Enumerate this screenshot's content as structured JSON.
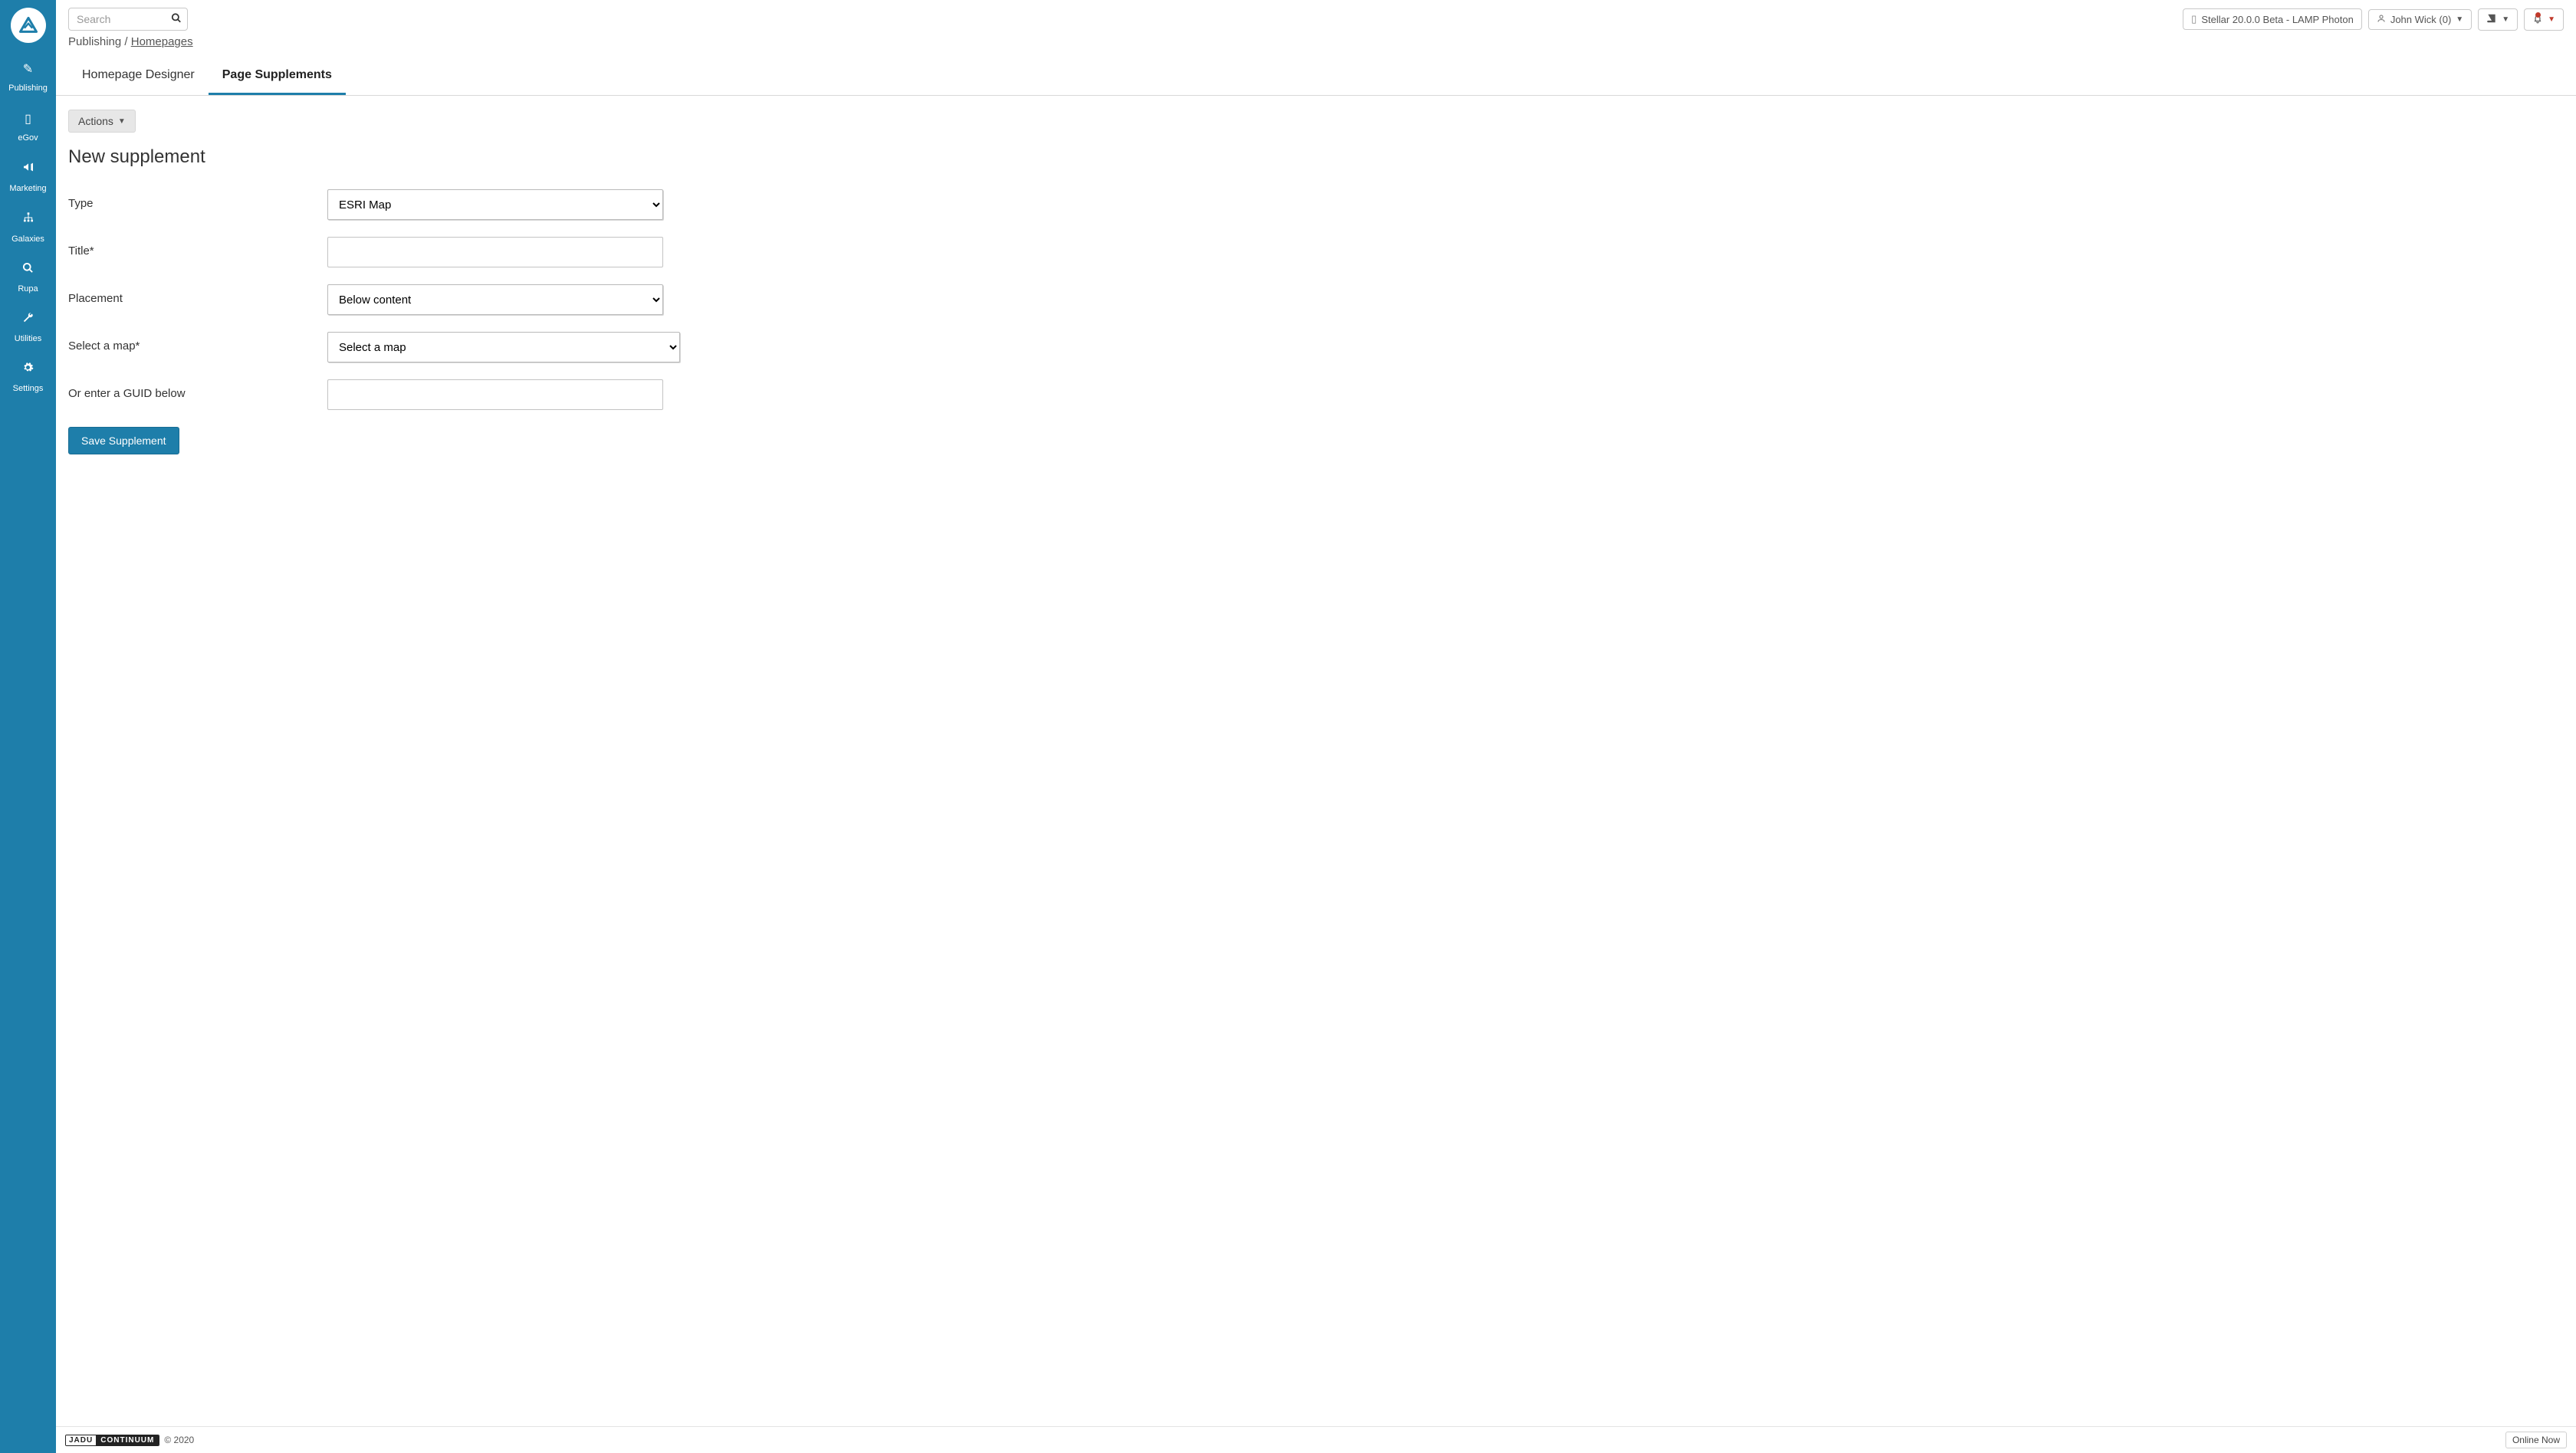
{
  "sidebar": {
    "items": [
      {
        "label": "Publishing"
      },
      {
        "label": "eGov"
      },
      {
        "label": "Marketing"
      },
      {
        "label": "Galaxies"
      },
      {
        "label": "Rupa"
      },
      {
        "label": "Utilities"
      },
      {
        "label": "Settings"
      }
    ]
  },
  "header": {
    "search_placeholder": "Search",
    "site_label": "Stellar 20.0.0 Beta - LAMP Photon",
    "user_label": "John Wick (0)"
  },
  "breadcrumb": {
    "section": "Publishing",
    "separator": "/",
    "page": "Homepages"
  },
  "tabs": [
    {
      "label": "Homepage Designer",
      "active": false
    },
    {
      "label": "Page Supplements",
      "active": true
    }
  ],
  "actions_label": "Actions",
  "page_heading": "New supplement",
  "form": {
    "type": {
      "label": "Type",
      "value": "ESRI Map"
    },
    "title": {
      "label": "Title*",
      "value": ""
    },
    "placement": {
      "label": "Placement",
      "value": "Below content"
    },
    "map": {
      "label": "Select a map*",
      "value": "Select a map"
    },
    "guid": {
      "label": "Or enter a GUID below",
      "value": ""
    },
    "save_label": "Save Supplement"
  },
  "footer": {
    "brand_left": "JADU",
    "brand_right": "CONTINUUM",
    "copyright": "© 2020",
    "online_label": "Online Now"
  }
}
